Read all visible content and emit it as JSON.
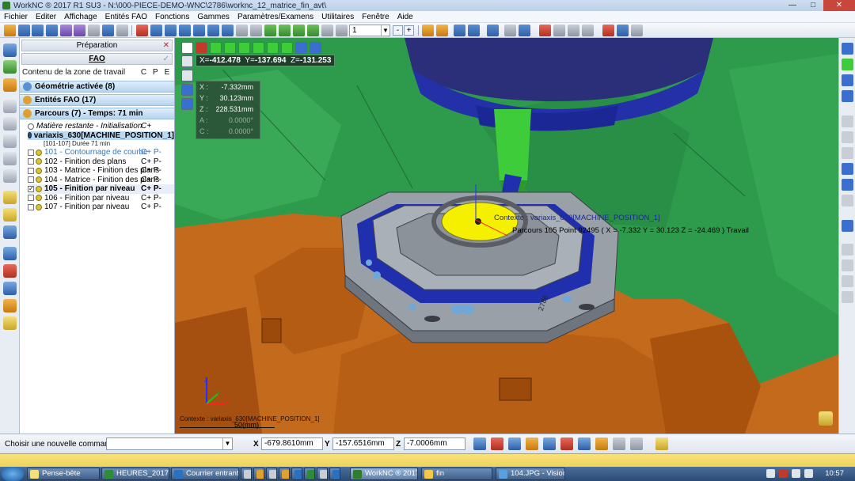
{
  "window": {
    "title": "WorkNC ® 2017 R1 SU3 - N:\\000-PIECE-DEMO-WNC\\2786\\worknc_12_matrice_fin_avt\\"
  },
  "menu": [
    "Fichier",
    "Editer",
    "Affichage",
    "Entités FAO",
    "Fonctions",
    "Gammes",
    "Paramètres/Examens",
    "Utilitaires",
    "Fenêtre",
    "Aide"
  ],
  "toolbar": {
    "layer_value": "1",
    "minus": "-",
    "plus": "+"
  },
  "panel": {
    "tab_preparation": "Préparation",
    "tab_fao": "FAO",
    "work_zone_title": "Contenu de la zone de travail",
    "columns": [
      "C",
      "P",
      "E"
    ],
    "sections": {
      "geometry": "Géométrie activée (8)",
      "entities": "Entités FAO (17)",
      "toolpaths": "Parcours (7) - Temps: 71 min"
    },
    "tree": {
      "stock": {
        "label": "Matière restante - Initialisation",
        "flags": "C+"
      },
      "machine": {
        "label": "variaxis_630[MACHINE_POSITION_1]",
        "sub": "[101-107] Durée 71 min"
      },
      "items": [
        {
          "label": "101 - Contournage de courbe",
          "flags": "C+  P-"
        },
        {
          "label": "102 - Finition des plans",
          "flags": "C+  P-"
        },
        {
          "label": "103 - Matrice - Finition des plans",
          "flags": "C+  P-"
        },
        {
          "label": "104 - Matrice - Finition des plans",
          "flags": "C+  P-"
        },
        {
          "label": "105 - Finition par niveau",
          "flags": "C+  P-"
        },
        {
          "label": "106 - Finition par niveau",
          "flags": "C+  P-"
        },
        {
          "label": "107 - Finition par niveau",
          "flags": "C+  P-"
        }
      ]
    }
  },
  "viewport": {
    "coords": {
      "x_label": "X=",
      "x": "-412.478",
      "y_label": "Y=",
      "y": "-137.694",
      "z_label": "Z=",
      "z": "-131.253"
    },
    "dro": [
      {
        "k": "X :",
        "v": "-7.332mm"
      },
      {
        "k": "Y :",
        "v": "30.123mm"
      },
      {
        "k": "Z :",
        "v": "228.531mm"
      },
      {
        "k": "A :",
        "v": "0.0000°"
      },
      {
        "k": "C :",
        "v": "0.0000°"
      }
    ],
    "context_label": "Contexte : variaxis_630[MACHINE_POSITION_1]",
    "toolpath_label": "Parcours 105 Point 92495 ( X = -7.332  Y = 30.123  Z = -24.469 ) Travail",
    "part_number": "2786",
    "status_context": "Contexte : variaxis_630[MACHINE_POSITION_1]",
    "scale_label": "50(mm)",
    "axis_labels": {
      "z": "Z",
      "y": "Y",
      "x": "X"
    }
  },
  "command_bar": {
    "prompt": "Choisir une nouvelle commande...",
    "x_label": "X",
    "x_value": "-679.8610mm",
    "y_label": "Y",
    "y_value": "-157.6516mm",
    "z_label": "Z",
    "z_value": "-7.0006mm"
  },
  "taskbar": {
    "tasks": [
      "Pense-bête",
      "HEURES_2017.xls ...",
      "Courrier entrant - ...",
      "WorkNC ® 2017 ...",
      "fin",
      "104.JPG - Visionn..."
    ],
    "clock": "10:57"
  },
  "colors": {
    "viewport_green": "#2e9b4c",
    "machine_orange": "#c46a1c",
    "head_navy": "#2b2f7a",
    "part_gray": "#9aa0a8",
    "part_blue": "#1f2fae",
    "highlight_yellow": "#f4f000",
    "section_blue": "#b6d4ee"
  }
}
